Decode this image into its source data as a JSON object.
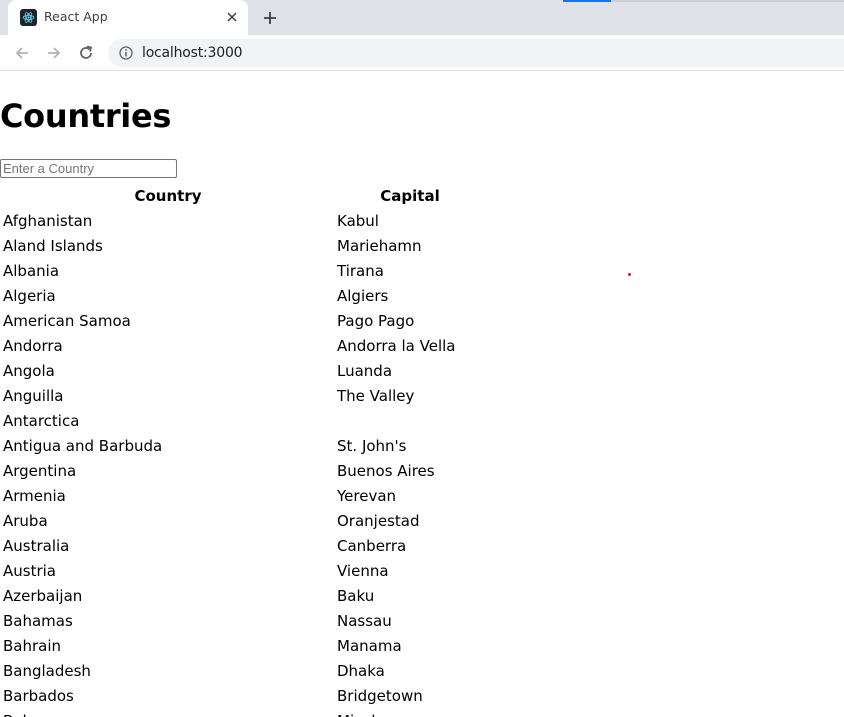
{
  "browser": {
    "tab_title": "React App",
    "url": "localhost:3000",
    "icons": {
      "favicon": "react-logo-icon",
      "close": "close-icon",
      "new_tab": "plus-icon",
      "back": "arrow-left-icon",
      "forward": "arrow-right-icon",
      "reload": "reload-icon",
      "site_info": "info-icon"
    }
  },
  "page": {
    "heading": "Countries",
    "search_placeholder": "Enter a Country",
    "table": {
      "headers": [
        "Country",
        "Capital"
      ],
      "rows": [
        [
          "Afghanistan",
          "Kabul"
        ],
        [
          "Aland Islands",
          "Mariehamn"
        ],
        [
          "Albania",
          "Tirana"
        ],
        [
          "Algeria",
          "Algiers"
        ],
        [
          "American Samoa",
          "Pago Pago"
        ],
        [
          "Andorra",
          "Andorra la Vella"
        ],
        [
          "Angola",
          "Luanda"
        ],
        [
          "Anguilla",
          "The Valley"
        ],
        [
          "Antarctica",
          ""
        ],
        [
          "Antigua and Barbuda",
          "St. John's"
        ],
        [
          "Argentina",
          "Buenos Aires"
        ],
        [
          "Armenia",
          "Yerevan"
        ],
        [
          "Aruba",
          "Oranjestad"
        ],
        [
          "Australia",
          "Canberra"
        ],
        [
          "Austria",
          "Vienna"
        ],
        [
          "Azerbaijan",
          "Baku"
        ],
        [
          "Bahamas",
          "Nassau"
        ],
        [
          "Bahrain",
          "Manama"
        ],
        [
          "Bangladesh",
          "Dhaka"
        ],
        [
          "Barbados",
          "Bridgetown"
        ],
        [
          "Belarus",
          "Minsk"
        ]
      ]
    }
  }
}
